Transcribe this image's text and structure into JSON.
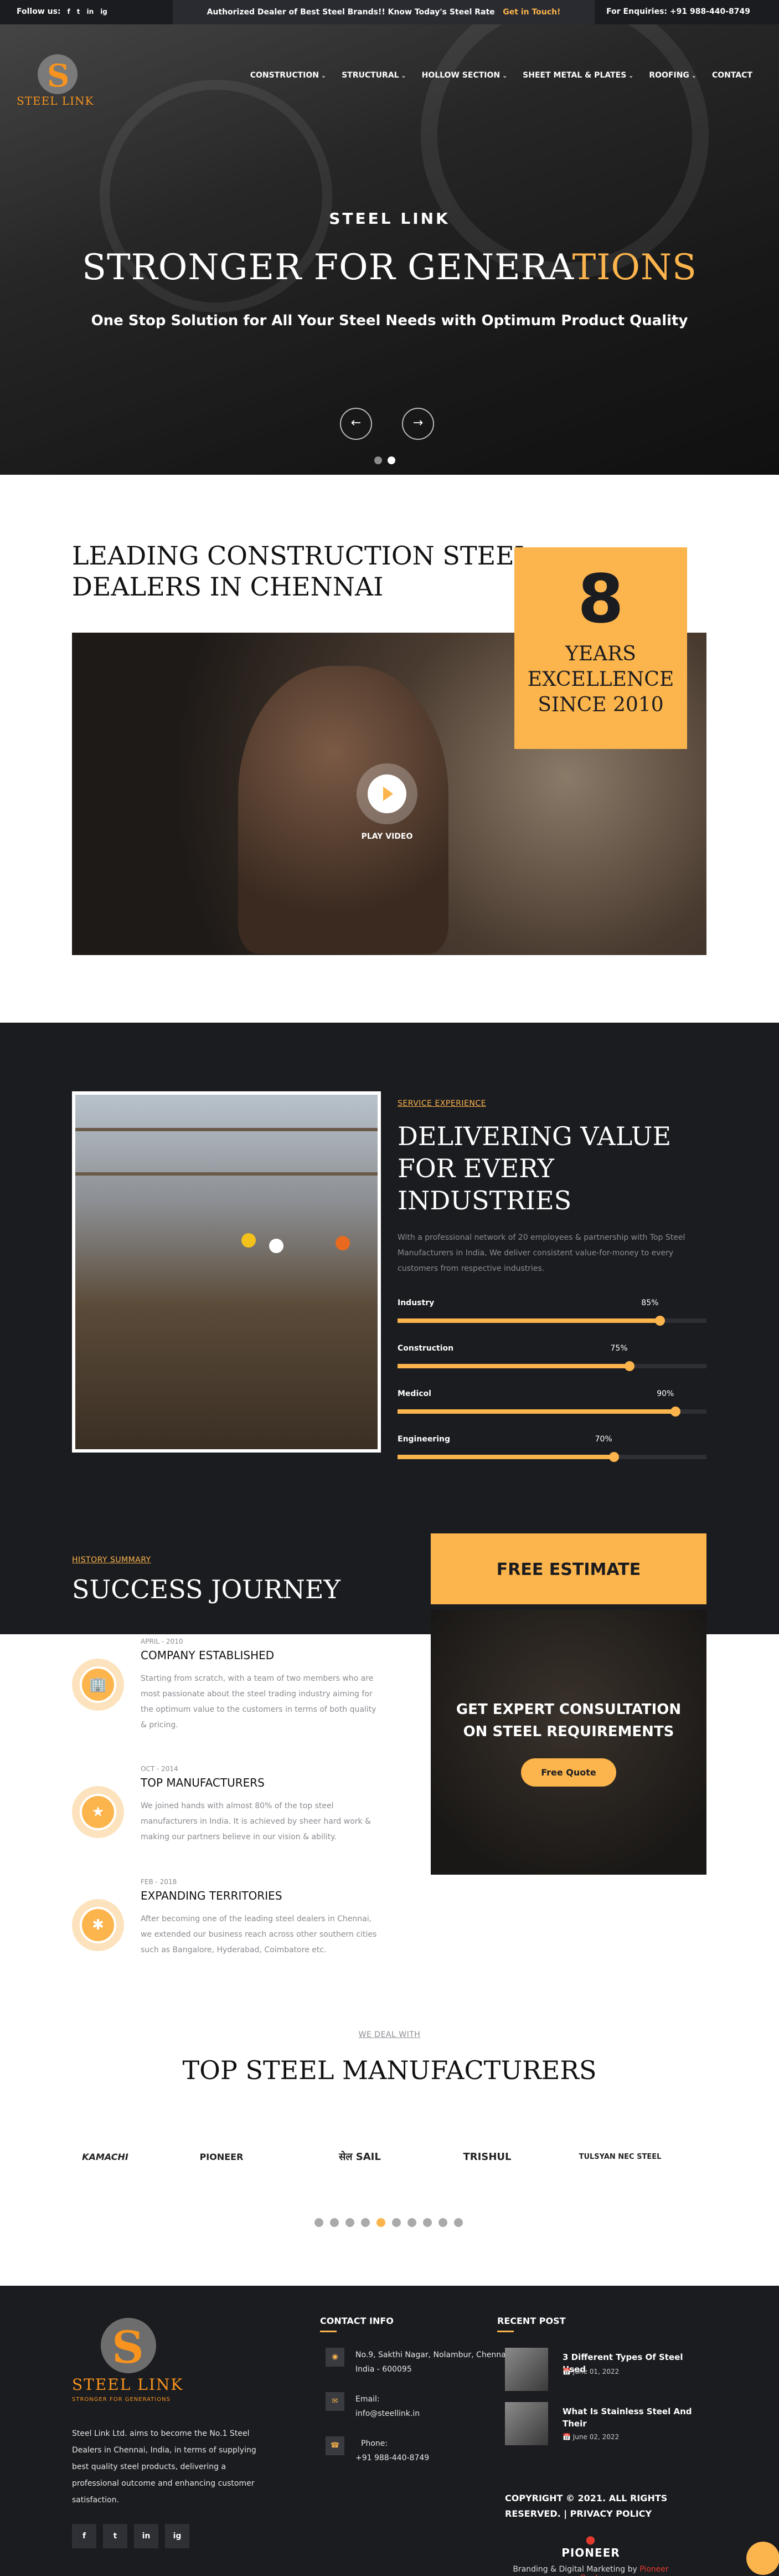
{
  "topbar": {
    "follow_label": "Follow us:",
    "social": [
      "f",
      "t",
      "in",
      "ig"
    ],
    "notice": "Authorized Dealer of Best Steel Brands!! Know Today's Steel Rate",
    "notice_link": "Get in Touch!",
    "enquiries": "For Enquiries: +91 988-440-8749"
  },
  "brand": {
    "logo_mark": "S",
    "logo_text": "STEEL LINK",
    "tagline": "STRONGER FOR GENERATIONS"
  },
  "nav": [
    "CONSTRUCTION",
    "STRUCTURAL",
    "HOLLOW SECTION",
    "SHEET METAL & PLATES",
    "ROOFING",
    "CONTACT"
  ],
  "hero": {
    "kicker": "STEEL LINK",
    "title_main": "STRONGER FOR GENERA",
    "title_accent": "TIONS",
    "subtitle": "One Stop Solution for All Your Steel Needs with Optimum Product Quality",
    "prev": "←",
    "next": "→"
  },
  "leading": {
    "title_line1": "LEADING CONSTRUCTION STEEL",
    "title_line2": "DEALERS IN CHENNAI",
    "play_label": "PLAY VIDEO",
    "badge_number": "8",
    "badge_line1": "YEARS",
    "badge_line2": "EXCELLENCE",
    "badge_line3": "SINCE 2010"
  },
  "deliver": {
    "eyebrow": "SERVICE EXPERIENCE",
    "title_line1": "DELIVERING VALUE",
    "title_line2": "FOR EVERY",
    "title_line3": "INDUSTRIES",
    "text": "With a professional network of 20 employees & partnership with Top Steel Manufacturers in India, We deliver consistent value-for-money to every customers from respective industries.",
    "skills": [
      {
        "label": "Industry",
        "value": 85,
        "display": "85%"
      },
      {
        "label": "Construction",
        "value": 75,
        "display": "75%"
      },
      {
        "label": "Medicol",
        "value": 90,
        "display": "90%"
      },
      {
        "label": "Engineering",
        "value": 70,
        "display": "70%"
      }
    ]
  },
  "journey": {
    "eyebrow": "HISTORY SUMMARY",
    "title": "SUCCESS JOURNEY",
    "items": [
      {
        "date": "APRIL - 2010",
        "title": "COMPANY ESTABLISHED",
        "text": "Starting from scratch, with a team of two members who are most passionate about the steel trading industry aiming for the optimum value to the customers in terms of both quality & pricing.",
        "icon": "building-icon"
      },
      {
        "date": "OCT - 2014",
        "title": "TOP MANUFACTURERS",
        "text": "We joined hands with almost 80% of the top steel manufacturers in India. It is achieved by sheer hard work & making our partners believe in our vision & ability.",
        "icon": "award-icon"
      },
      {
        "date": "FEB - 2018",
        "title": "EXPANDING TERRITORIES",
        "text": "After becoming one of the leading steel dealers in Chennai, we extended our business reach across other southern cities such as Bangalore, Hyderabad, Coimbatore etc.",
        "icon": "network-icon"
      }
    ]
  },
  "estimate": {
    "header": "FREE ESTIMATE",
    "title_line1": "GET EXPERT CONSULTATION",
    "title_line2": "ON STEEL REQUIREMENTS",
    "button": "Free Quote"
  },
  "manufacturers": {
    "eyebrow": "WE DEAL WITH",
    "title": "TOP STEEL MANUFACTURERS",
    "brands": [
      "KAMACHI",
      "PIONEER",
      "सेल SAIL",
      "TRISHUL",
      "TULSYAN NEC STEEL"
    ],
    "dot_count": 10,
    "active_dot": 4
  },
  "footer": {
    "tagline": "STRONGER FOR GENERATIONS",
    "about": "Steel Link Ltd. aims to become the No.1 Steel Dealers in Chennai, India, in terms of supplying best quality steel products, delivering a professional outcome and enhancing customer satisfaction.",
    "social": [
      "f",
      "t",
      "in",
      "ig"
    ],
    "contact_heading": "CONTACT INFO",
    "address": "No.9, Sakthi Nagar, Nolambur, Chennai, India - 600095",
    "email_label": "Email:",
    "email": "info@steellink.in",
    "phone_label": "Phone:",
    "phone": "+91 988-440-8749",
    "posts_heading": "RECENT POST",
    "posts": [
      {
        "title": "3 Different Types Of Steel Used",
        "date": "June 01, 2022"
      },
      {
        "title": "What Is Stainless Steel And Their",
        "date": "June 02, 2022"
      }
    ],
    "copyright": "COPYRIGHT © 2021. ALL RIGHTS RESERVED. | PRIVACY POLICY",
    "agency_logo": "PIONEER",
    "agency_credit": "Branding & Digital Marketing by",
    "agency_link": "Pioneer Goals"
  },
  "colors": {
    "accent": "#fcb44c",
    "dark": "#1b1c20",
    "logo_orange": "#f7931e"
  }
}
